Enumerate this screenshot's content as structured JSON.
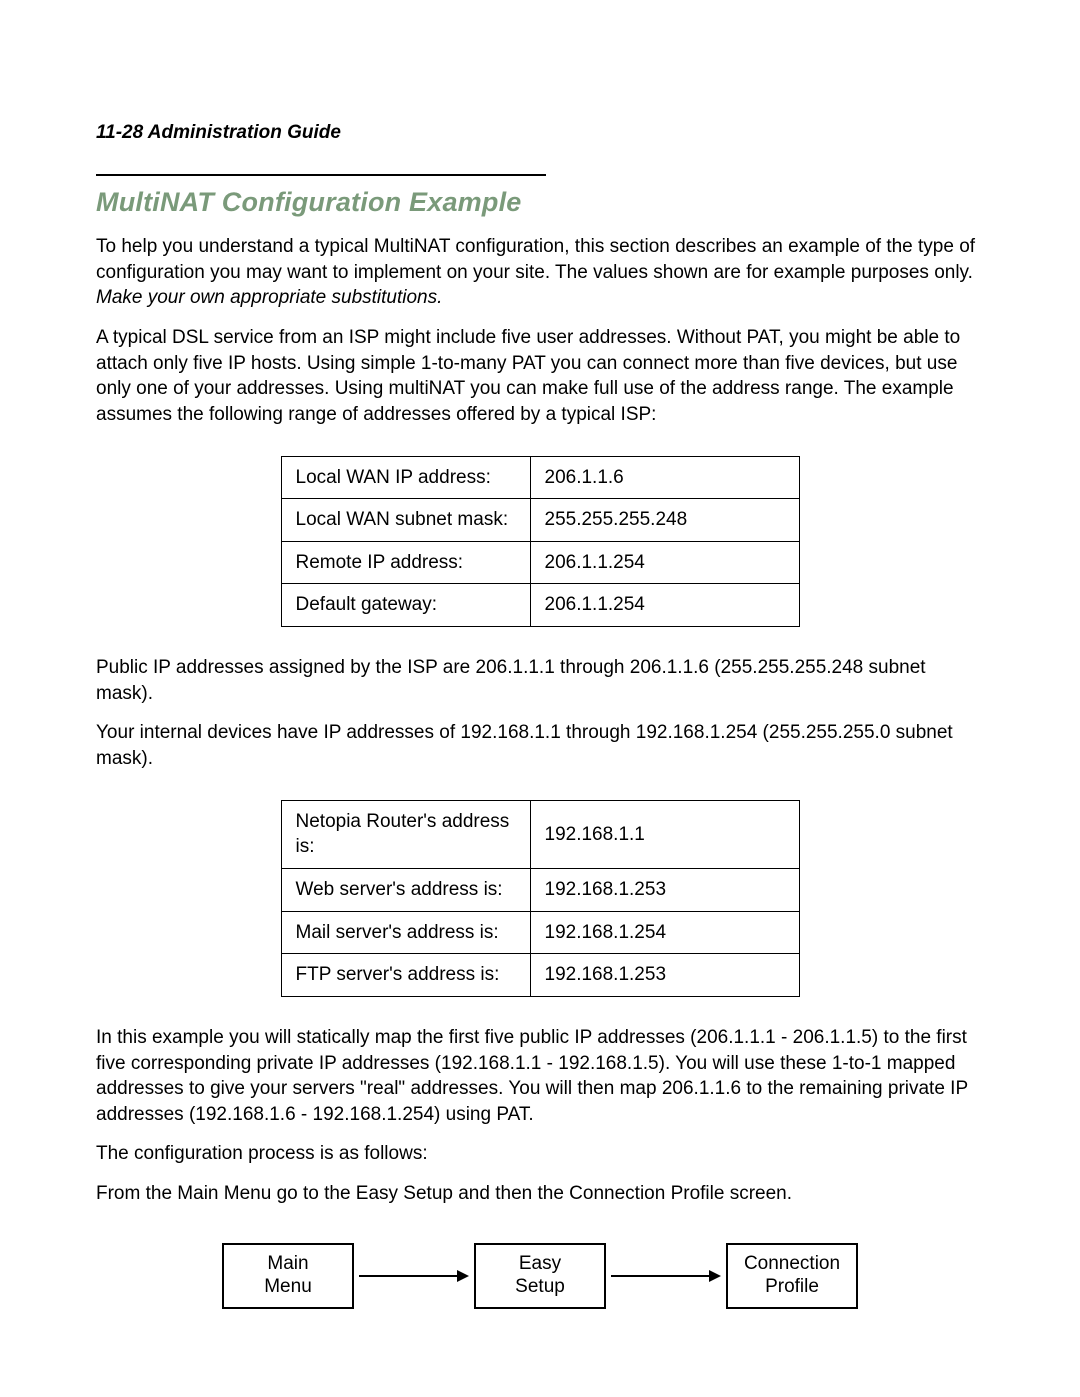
{
  "header": "11-28  Administration Guide",
  "section_title": "MultiNAT Configuration Example",
  "p1": "To help you understand a typical MultiNAT configuration, this section describes an example of the type of configuration you may want to implement on your site. The values shown are for example purposes only. ",
  "p1_ital": "Make your own appropriate substitutions.",
  "p2": "A typical DSL service from an ISP might include five user addresses. Without PAT, you might be able to attach only five IP hosts. Using simple 1-to-many PAT you can connect more than five devices, but use only one of your addresses. Using multiNAT you can make full use of the address range. The example assumes the following range of addresses offered by a typical ISP:",
  "table1": [
    {
      "label": "Local WAN IP address:",
      "value": "206.1.1.6"
    },
    {
      "label": "Local WAN subnet mask:",
      "value": "255.255.255.248"
    },
    {
      "label": "Remote IP address:",
      "value": "206.1.1.254"
    },
    {
      "label": "Default gateway:",
      "value": "206.1.1.254"
    }
  ],
  "p3": "Public IP addresses assigned by the ISP are 206.1.1.1 through 206.1.1.6 (255.255.255.248 subnet mask).",
  "p4": "Your internal devices have IP addresses of 192.168.1.1 through 192.168.1.254 (255.255.255.0 subnet mask).",
  "table2": [
    {
      "label": "Netopia Router's address is:",
      "value": "192.168.1.1"
    },
    {
      "label": "Web server's address is:",
      "value": "192.168.1.253"
    },
    {
      "label": "Mail server's address is:",
      "value": "192.168.1.254"
    },
    {
      "label": "FTP server's address is:",
      "value": "192.168.1.253"
    }
  ],
  "p5": "In this example you will statically map the first five public IP addresses (206.1.1.1 - 206.1.1.5) to the first five corresponding private IP addresses (192.168.1.1 - 192.168.1.5). You will use these 1-to-1 mapped addresses to give your servers \"real\" addresses. You will then map 206.1.1.6 to the remaining private IP addresses (192.168.1.6 - 192.168.1.254) using PAT.",
  "p6": "The configuration process is as follows:",
  "p7": "From the Main Menu go to the Easy Setup and then the Connection Profile screen.",
  "flow": {
    "box1": "Main\nMenu",
    "box2": "Easy\nSetup",
    "box3": "Connection\nProfile"
  }
}
